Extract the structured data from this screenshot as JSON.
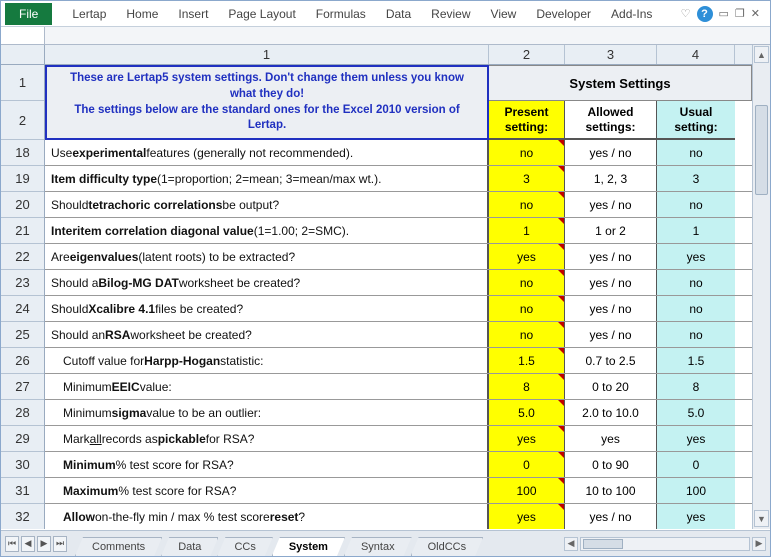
{
  "ribbon": {
    "file": "File",
    "tabs": [
      "Lertap",
      "Home",
      "Insert",
      "Page Layout",
      "Formulas",
      "Data",
      "Review",
      "View",
      "Developer",
      "Add-Ins"
    ]
  },
  "column_headers": [
    "1",
    "2",
    "3",
    "4"
  ],
  "banner": {
    "line1": "These are Lertap5 system settings. Don't change them unless you know what they do!",
    "line2": "The settings below are the standard ones for the Excel 2010 version of Lertap."
  },
  "system_title": "System Settings",
  "heads": {
    "present": "Present setting:",
    "allowed": "Allowed settings:",
    "usual": "Usual setting:"
  },
  "row_numbers": [
    "1",
    "2",
    "18",
    "19",
    "20",
    "21",
    "22",
    "23",
    "24",
    "25",
    "26",
    "27",
    "28",
    "29",
    "30",
    "31",
    "32"
  ],
  "rows": [
    {
      "n": "18",
      "desc_html": "Use <b>experimental</b> features (generally not recommended).",
      "present": "no",
      "allowed": "yes / no",
      "usual": "no"
    },
    {
      "n": "19",
      "desc_html": "<b>Item difficulty type</b> (1=proportion; 2=mean; 3=mean/max wt.).",
      "present": "3",
      "allowed": "1, 2, 3",
      "usual": "3"
    },
    {
      "n": "20",
      "desc_html": "Should <b>tetrachoric correlations</b> be output?",
      "present": "no",
      "allowed": "yes / no",
      "usual": "no"
    },
    {
      "n": "21",
      "desc_html": "<b>Interitem correlation diagonal value</b> (1=1.00; 2=SMC).",
      "present": "1",
      "allowed": "1 or 2",
      "usual": "1"
    },
    {
      "n": "22",
      "desc_html": "Are <b>eigenvalues</b> (latent roots) to be extracted?",
      "present": "yes",
      "allowed": "yes / no",
      "usual": "yes"
    },
    {
      "n": "23",
      "desc_html": "Should a <b>Bilog-MG DAT</b> worksheet be created?",
      "present": "no",
      "allowed": "yes / no",
      "usual": "no"
    },
    {
      "n": "24",
      "desc_html": "Should <b>Xcalibre 4.1</b> files be created?",
      "present": "no",
      "allowed": "yes / no",
      "usual": "no"
    },
    {
      "n": "25",
      "desc_html": "Should an <b>RSA</b> worksheet be created?",
      "present": "no",
      "allowed": "yes / no",
      "usual": "no"
    },
    {
      "n": "26",
      "indent": true,
      "desc_html": "Cutoff value for <b>Harpp-Hogan</b> statistic:",
      "present": "1.5",
      "allowed": "0.7 to 2.5",
      "usual": "1.5"
    },
    {
      "n": "27",
      "indent": true,
      "desc_html": "Minimum <b>EEIC</b> value:",
      "present": "8",
      "allowed": "0 to 20",
      "usual": "8"
    },
    {
      "n": "28",
      "indent": true,
      "desc_html": "Minimum <b>sigma</b> value to be an outlier:",
      "present": "5.0",
      "allowed": "2.0 to 10.0",
      "usual": "5.0"
    },
    {
      "n": "29",
      "indent": true,
      "desc_html": "Mark <u>all</u> records as <b>pickable</b> for RSA?",
      "present": "yes",
      "allowed": "yes",
      "usual": "yes"
    },
    {
      "n": "30",
      "indent": true,
      "desc_html": "<b>Minimum</b> % test score for RSA?",
      "present": "0",
      "allowed": "0 to 90",
      "usual": "0"
    },
    {
      "n": "31",
      "indent": true,
      "desc_html": "<b>Maximum</b> % test score for RSA?",
      "present": "100",
      "allowed": "10 to 100",
      "usual": "100"
    },
    {
      "n": "32",
      "indent": true,
      "desc_html": "<b>Allow</b> on-the-fly min / max % test score <b>reset</b>?",
      "present": "yes",
      "allowed": "yes / no",
      "usual": "yes"
    }
  ],
  "sheet_tabs": [
    "Comments",
    "Data",
    "CCs",
    "System",
    "Syntax",
    "OldCCs"
  ],
  "active_tab": "System"
}
